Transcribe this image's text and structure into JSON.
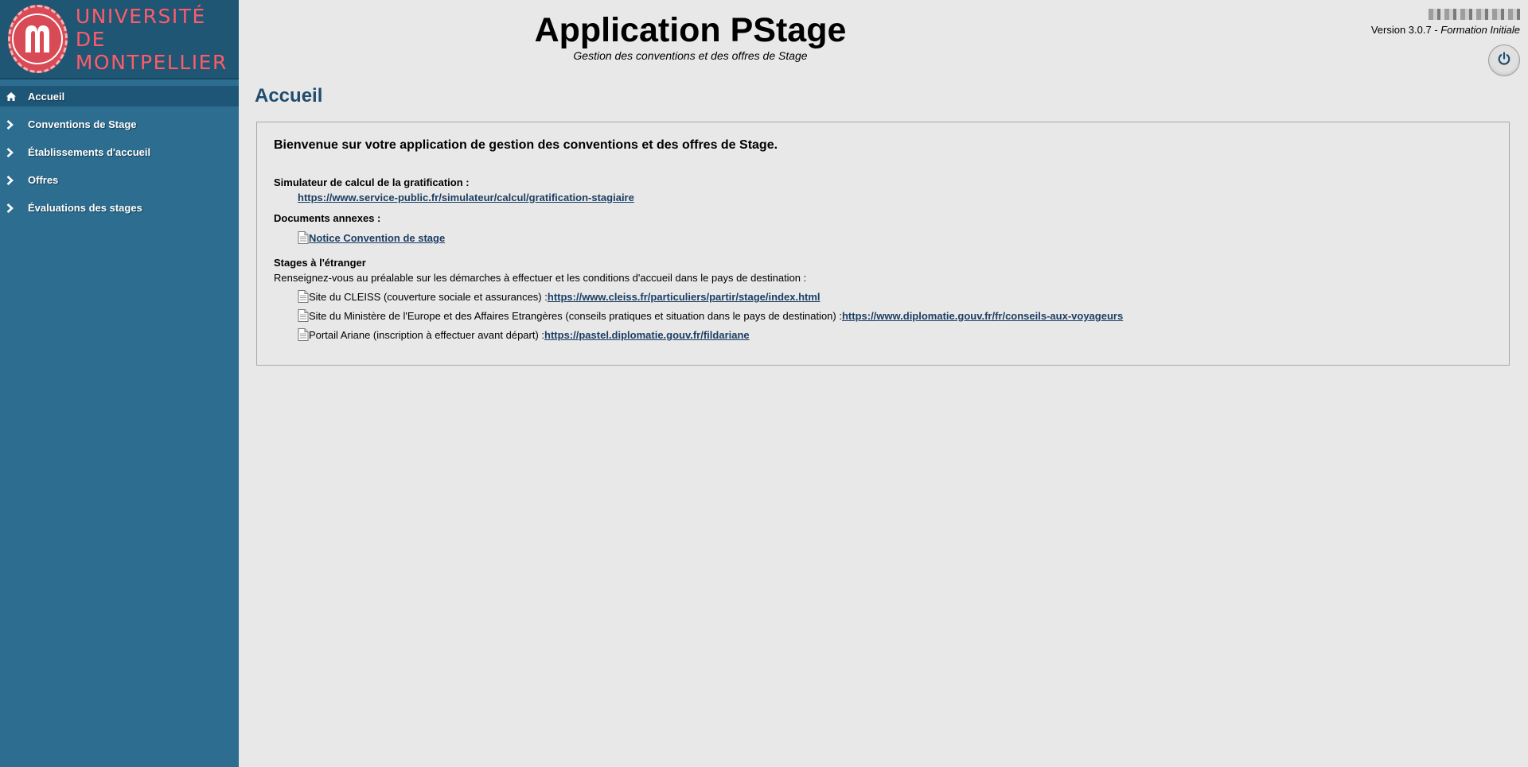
{
  "sidebar": {
    "logo": {
      "line1": "UNIVERSITÉ",
      "line2": "DE MONTPELLIER",
      "seal_text": "UNIVERSITÉ DE MONTPELLIER",
      "color": "#ff5b6a"
    },
    "items": [
      {
        "label": "Accueil",
        "icon": "home-icon",
        "active": true
      },
      {
        "label": "Conventions de Stage",
        "icon": "chevron-right-icon"
      },
      {
        "label": "Établissements d'accueil",
        "icon": "chevron-right-icon"
      },
      {
        "label": "Offres",
        "icon": "chevron-right-icon"
      },
      {
        "label": "Évaluations des stages",
        "icon": "chevron-right-icon"
      }
    ]
  },
  "header": {
    "title": "Application PStage",
    "subtitle": "Gestion des conventions et des offres de Stage",
    "version_prefix": "Version 3.0.7 - ",
    "version_mode": "Formation Initiale",
    "logout_icon": "power-icon"
  },
  "main": {
    "heading": "Accueil",
    "welcome": "Bienvenue sur votre application de gestion des conventions et des offres de Stage.",
    "simulator": {
      "title": "Simulateur de calcul de la gratification :",
      "link": "https://www.service-public.fr/simulateur/calcul/gratification-stagiaire"
    },
    "documents": {
      "title": "Documents annexes :",
      "link": " Notice Convention de stage"
    },
    "abroad": {
      "title": "Stages à l'étranger",
      "intro": "Renseignez-vous au préalable sur les démarches à effectuer et les conditions d'accueil dans le pays de destination :",
      "items": [
        {
          "text": "Site du CLEISS (couverture sociale et assurances) :",
          "link": " https://www.cleiss.fr/particuliers/partir/stage/index.html"
        },
        {
          "text": "Site du Ministère de l'Europe et des Affaires Etrangères (conseils pratiques et situation dans le pays de destination) :",
          "link": " https://www.diplomatie.gouv.fr/fr/conseils-aux-voyageurs"
        },
        {
          "text": "Portail Ariane (inscription à effectuer avant départ) :",
          "link": " https://pastel.diplomatie.gouv.fr/fildariane"
        }
      ]
    }
  },
  "colors": {
    "sidebar_bg": "#2c6d90",
    "sidebar_active": "#1d5677",
    "heading": "#1f4c6f",
    "link": "#1b3e63",
    "page_bg": "#e8e8e8"
  }
}
